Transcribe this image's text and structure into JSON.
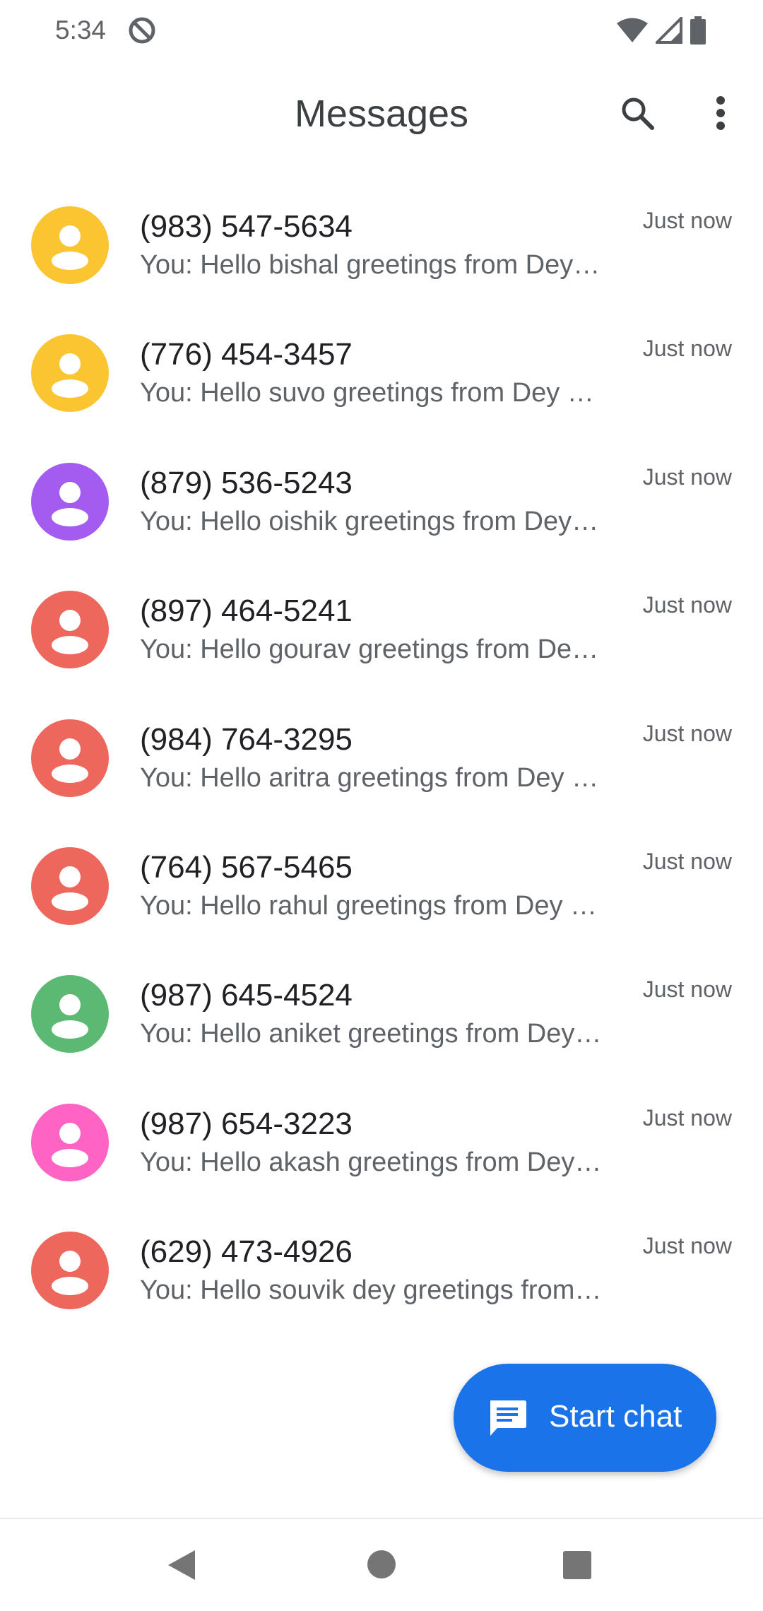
{
  "status_bar": {
    "time": "5:34",
    "icons": [
      "do-not-disturb-icon",
      "wifi-icon",
      "cell-signal-icon",
      "battery-icon"
    ]
  },
  "app_bar": {
    "title": "Messages",
    "icons": [
      "search-icon",
      "more-vert-icon"
    ]
  },
  "conversations": [
    {
      "name": "(983) 547-5634",
      "snippet": "You: Hello bishal greetings from Dey…",
      "time": "Just now",
      "avatar_color": "#fbc531"
    },
    {
      "name": "(776) 454-3457",
      "snippet": "You: Hello suvo greetings from Dey …",
      "time": "Just now",
      "avatar_color": "#fbc531"
    },
    {
      "name": "(879) 536-5243",
      "snippet": "You: Hello oishik greetings from Dey…",
      "time": "Just now",
      "avatar_color": "#a45cf0"
    },
    {
      "name": "(897) 464-5241",
      "snippet": "You: Hello gourav greetings from De…",
      "time": "Just now",
      "avatar_color": "#ee675c"
    },
    {
      "name": "(984) 764-3295",
      "snippet": "You: Hello aritra greetings from Dey …",
      "time": "Just now",
      "avatar_color": "#ee675c"
    },
    {
      "name": "(764) 567-5465",
      "snippet": "You: Hello rahul greetings from Dey …",
      "time": "Just now",
      "avatar_color": "#ee675c"
    },
    {
      "name": "(987) 645-4524",
      "snippet": "You: Hello aniket greetings from Dey…",
      "time": "Just now",
      "avatar_color": "#5bb974"
    },
    {
      "name": "(987) 654-3223",
      "snippet": "You: Hello akash greetings from Dey…",
      "time": "Just now",
      "avatar_color": "#ff63c3"
    },
    {
      "name": "(629) 473-4926",
      "snippet": "You: Hello souvik dey greetings from…",
      "time": "Just now",
      "avatar_color": "#ee675c"
    }
  ],
  "fab": {
    "label": "Start chat",
    "icon": "chat-icon",
    "color": "#1a73e8"
  },
  "nav_bar": {
    "icons": [
      "back-icon",
      "home-icon",
      "recents-icon"
    ]
  }
}
